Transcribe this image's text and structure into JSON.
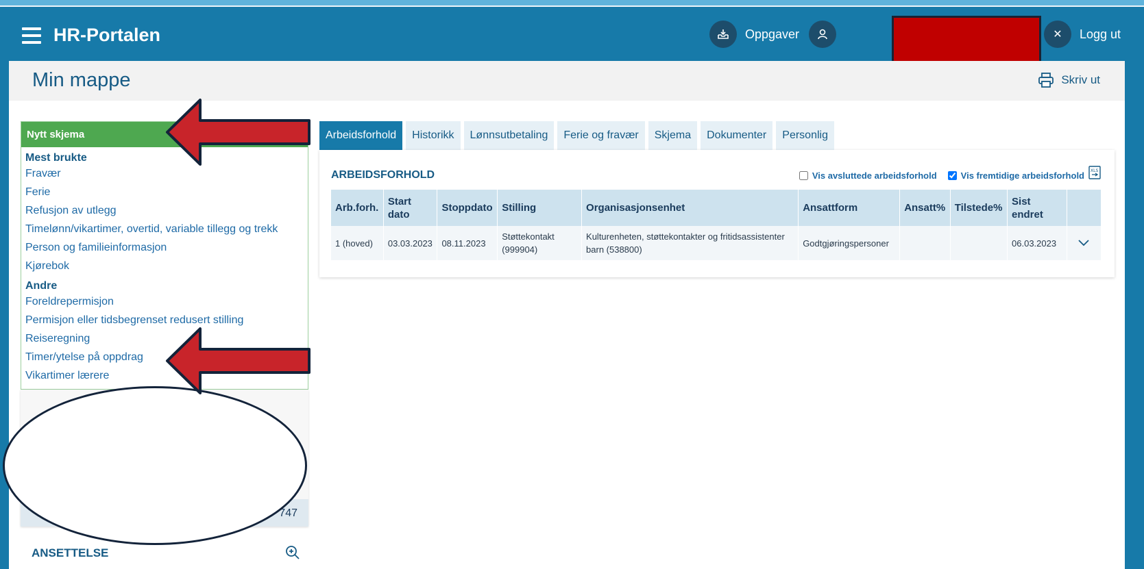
{
  "header": {
    "app_title": "HR-Portalen",
    "tasks_label": "Oppgaver",
    "logout_label": "Logg ut"
  },
  "page": {
    "title": "Min mappe",
    "print_label": "Skriv ut"
  },
  "form_panel": {
    "title": "Nytt skjema",
    "groups": [
      {
        "label": "Mest brukte",
        "items": [
          "Fravær",
          "Ferie",
          "Refusjon av utlegg",
          "Timelønn/vikartimer, overtid, variable tillegg og trekk",
          "Person og familieinformasjon",
          "Kjørebok"
        ]
      },
      {
        "label": "Andre",
        "items": [
          "Foreldrepermisjon",
          "Permisjon eller tidsbegrenset redusert stilling",
          "Reiseregning",
          "Timer/ytelse på oppdrag",
          "Vikartimer lærere"
        ]
      }
    ]
  },
  "profile": {
    "number_suffix": "747"
  },
  "section": {
    "title": "ANSETTELSE"
  },
  "tabs": [
    "Arbeidsforhold",
    "Historikk",
    "Lønnsutbetaling",
    "Ferie og fravær",
    "Skjema",
    "Dokumenter",
    "Personlig"
  ],
  "employment": {
    "title": "ARBEIDSFORHOLD",
    "show_ended_label": "Vis avsluttede arbeidsforhold",
    "show_future_label": "Vis fremtidige arbeidsforhold",
    "columns": [
      "Arb.forh.",
      "Start dato",
      "Stoppdato",
      "Stilling",
      "Organisasjonsenhet",
      "Ansattform",
      "Ansatt%",
      "Tilstede%",
      "Sist endret"
    ],
    "rows": [
      [
        "1 (hoved)",
        "03.03.2023",
        "08.11.2023",
        "Støttekontakt (999904)",
        "Kulturenheten, støttekontakter og fritidsassistenter barn (538800)",
        "Godtgjøringspersoner",
        "",
        "",
        "06.03.2023"
      ]
    ]
  },
  "colors": {
    "brand": "#177aa9",
    "form_header": "#4ea850",
    "annotation_arrow": "#c8242a"
  }
}
